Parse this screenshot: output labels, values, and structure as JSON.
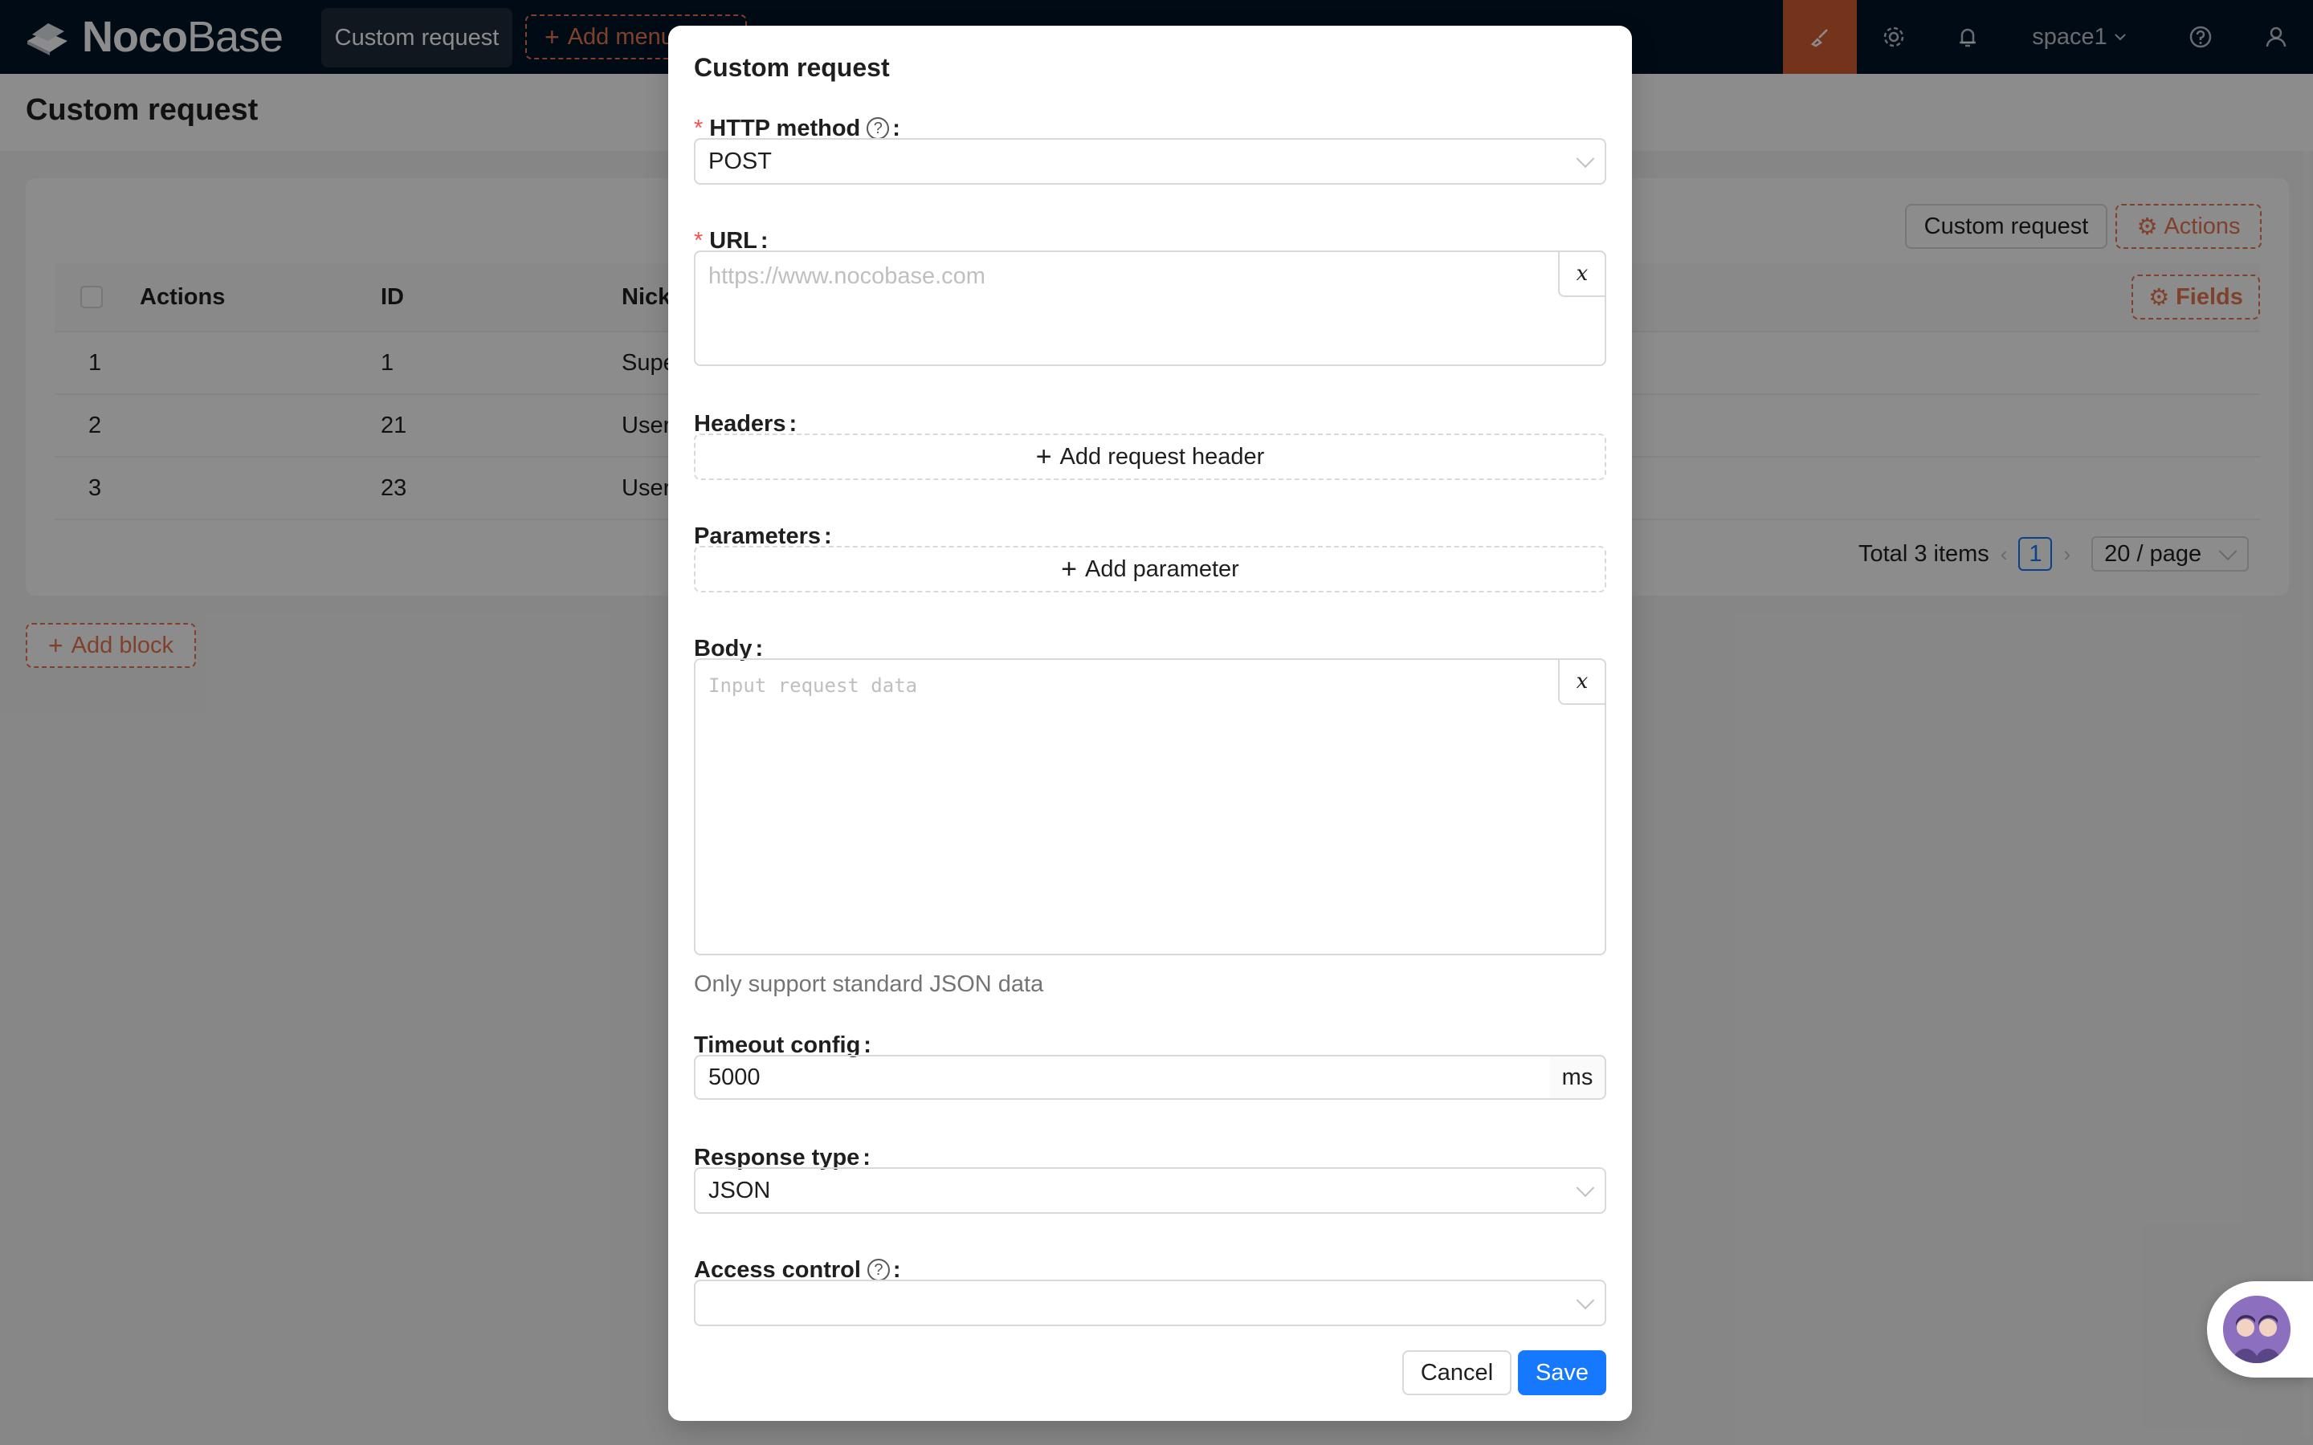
{
  "app": {
    "logo_strong": "Noco",
    "logo_light": "Base",
    "active_menu": "Custom request",
    "add_menu": "Add menu",
    "space": "space1"
  },
  "page": {
    "title": "Custom request",
    "card": {
      "custom_request_btn": "Custom request",
      "actions_btn": "Actions",
      "fields_btn": "Fields",
      "columns": [
        "Actions",
        "ID",
        "Nickname"
      ],
      "rows": [
        {
          "index": "1",
          "id": "1",
          "nickname": "Super Admin"
        },
        {
          "index": "2",
          "id": "21",
          "nickname": "User"
        },
        {
          "index": "3",
          "id": "23",
          "nickname": "User"
        }
      ],
      "pager": {
        "total": "Total 3 items",
        "current": "1",
        "page_size": "20 / page"
      }
    },
    "add_block": "Add block"
  },
  "modal": {
    "title": "Custom request",
    "http_method": {
      "label": "HTTP method",
      "value": "POST"
    },
    "url": {
      "label": "URL",
      "placeholder": "https://www.nocobase.com",
      "var_btn": "x"
    },
    "headers": {
      "label": "Headers",
      "add": "Add request header"
    },
    "parameters": {
      "label": "Parameters",
      "add": "Add parameter"
    },
    "body": {
      "label": "Body",
      "placeholder": "Input request data",
      "var_btn": "x",
      "help": "Only support standard JSON data"
    },
    "timeout": {
      "label": "Timeout config",
      "value": "5000",
      "unit": "ms"
    },
    "response_type": {
      "label": "Response type",
      "value": "JSON"
    },
    "access_control": {
      "label": "Access control",
      "value": ""
    },
    "cancel": "Cancel",
    "save": "Save"
  },
  "colors": {
    "topbar": "#001529",
    "accent": "#e8774f",
    "editor_active": "#d35f34",
    "primary": "#1677ff",
    "required": "#ff4d4f"
  },
  "icons": [
    "nocobase-logo-icon",
    "brush-icon",
    "gear-icon",
    "bell-icon",
    "chevron-down-icon",
    "question-circle-icon",
    "user-icon",
    "plus-icon",
    "variable-x-icon",
    "ai-assistant-avatar"
  ]
}
